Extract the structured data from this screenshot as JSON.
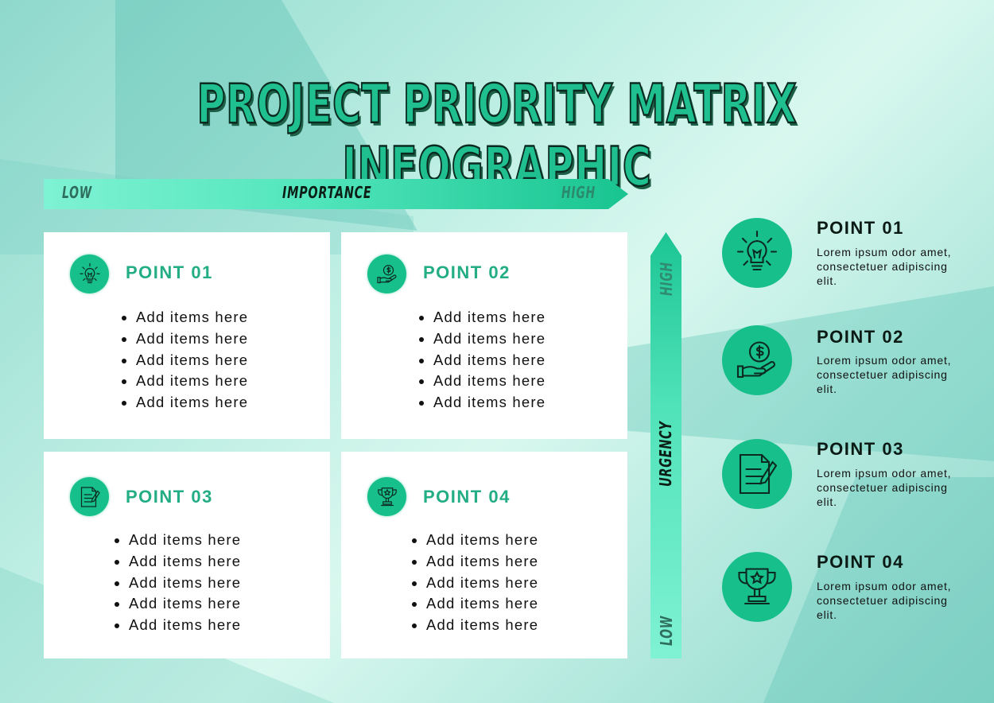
{
  "title": "PROJECT PRIORITY MATRIX INFOGRAPHIC",
  "colors": {
    "accent": "#17bf8a",
    "card_title": "#23ad85",
    "text_dark": "#0b1a14",
    "card_bg": "#ffffff"
  },
  "importance_axis": {
    "label": "IMPORTANCE",
    "low": "LOW",
    "high": "HIGH"
  },
  "urgency_axis": {
    "label": "URGENCY",
    "low": "LOW",
    "high": "HIGH"
  },
  "quadrants": [
    {
      "title": "POINT 01",
      "icon": "lightbulb-icon",
      "items": [
        "Add items here",
        "Add items here",
        "Add items here",
        "Add items here",
        "Add items here"
      ]
    },
    {
      "title": "POINT 02",
      "icon": "money-hand-icon",
      "items": [
        "Add items here",
        "Add items here",
        "Add items here",
        "Add items here",
        "Add items here"
      ]
    },
    {
      "title": "POINT 03",
      "icon": "document-pen-icon",
      "items": [
        "Add items here",
        "Add items here",
        "Add items here",
        "Add items here",
        "Add items here"
      ]
    },
    {
      "title": "POINT 04",
      "icon": "trophy-icon",
      "items": [
        "Add items here",
        "Add items here",
        "Add items here",
        "Add items here",
        "Add items here"
      ]
    }
  ],
  "legend": [
    {
      "title": "POINT 01",
      "icon": "lightbulb-icon",
      "description": "Lorem ipsum odor amet, consectetuer adipiscing elit."
    },
    {
      "title": "POINT 02",
      "icon": "money-hand-icon",
      "description": "Lorem ipsum odor amet, consectetuer adipiscing elit."
    },
    {
      "title": "POINT 03",
      "icon": "document-pen-icon",
      "description": "Lorem ipsum odor amet, consectetuer adipiscing elit."
    },
    {
      "title": "POINT 04",
      "icon": "trophy-icon",
      "description": "Lorem ipsum odor amet, consectetuer adipiscing elit."
    }
  ]
}
